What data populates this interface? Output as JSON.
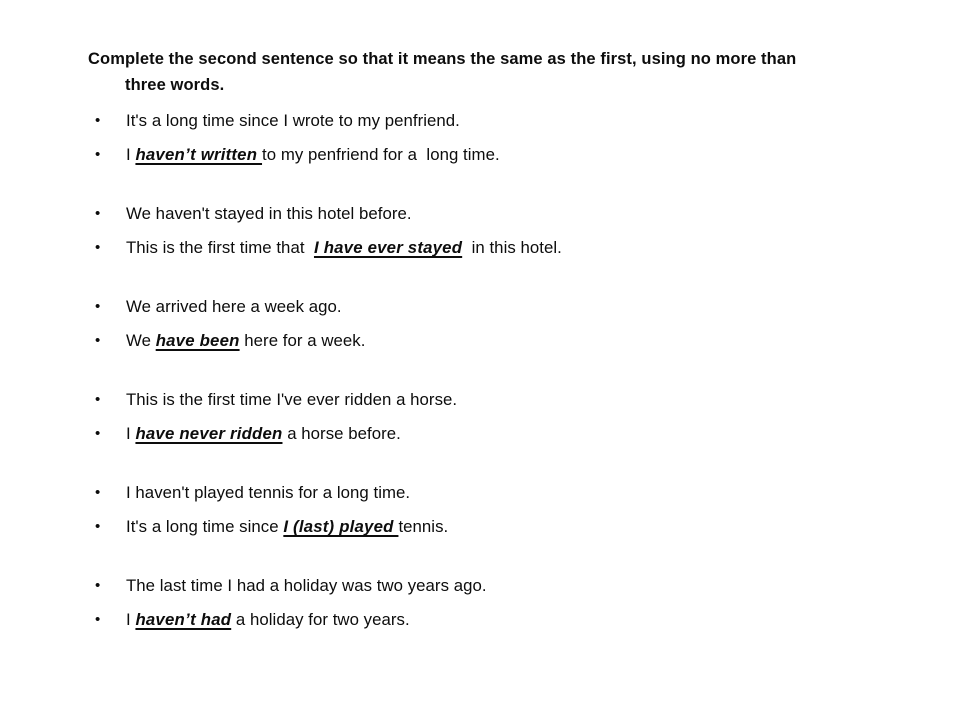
{
  "slide": {
    "background_color": "#ffffff",
    "text_color": "#0d0d0d",
    "title": {
      "line1": "Complete the second sentence so that it means the same as the first, using no more than",
      "line2": "three words."
    },
    "bullet_marker": "•",
    "groups": [
      {
        "prompt": {
          "before": "It's a long time since I wrote to my penfriend.",
          "answer": "",
          "after": ""
        },
        "response": {
          "before": "I ",
          "answer": "haven’t written ",
          "after": "to my penfriend for a  long time."
        }
      },
      {
        "prompt": {
          "before": "We haven't stayed in this hotel before.",
          "answer": "",
          "after": ""
        },
        "response": {
          "before": "This is the first time that  ",
          "answer": "I have ever stayed",
          "after": "  in this hotel."
        }
      },
      {
        "prompt": {
          "before": "We arrived here a week ago.",
          "answer": "",
          "after": ""
        },
        "response": {
          "before": "We ",
          "answer": "have been",
          "after": " here for a week."
        }
      },
      {
        "prompt": {
          "before": "This is the first time I've ever ridden a horse.",
          "answer": "",
          "after": ""
        },
        "response": {
          "before": "I ",
          "answer": "have never ridden",
          "after": " a horse before."
        }
      },
      {
        "prompt": {
          "before": "I haven't played tennis for a long time.",
          "answer": "",
          "after": ""
        },
        "response": {
          "before": "It's a long time since ",
          "answer": "I (last) played ",
          "after": "tennis."
        }
      },
      {
        "prompt": {
          "before": "The last time I had a holiday was two years ago.",
          "answer": "",
          "after": ""
        },
        "response": {
          "before": "I ",
          "answer": "haven’t had",
          "after": " a holiday for two years."
        }
      }
    ]
  }
}
